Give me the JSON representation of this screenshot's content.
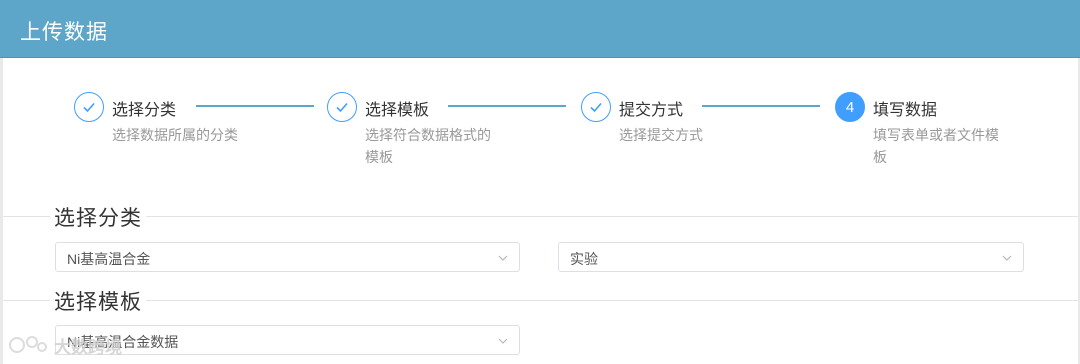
{
  "header": {
    "title": "上传数据"
  },
  "steps": [
    {
      "title": "选择分类",
      "desc": "选择数据所属的分类",
      "status": "done"
    },
    {
      "title": "选择模板",
      "desc": "选择符合数据格式的模板",
      "status": "done"
    },
    {
      "title": "提交方式",
      "desc": "选择提交方式",
      "status": "done"
    },
    {
      "title": "填写数据",
      "desc": "填写表单或者文件模板",
      "status": "active",
      "number": "4"
    }
  ],
  "sections": {
    "category": {
      "title": "选择分类",
      "select1_value": "Ni基高温合金",
      "select2_value": "实验"
    },
    "template": {
      "title": "选择模板",
      "select_value": "Ni基高温合金数据"
    }
  },
  "watermark": {
    "text": "大数跨境"
  },
  "colors": {
    "header": "#5ea6c9",
    "accent": "#409eff"
  }
}
